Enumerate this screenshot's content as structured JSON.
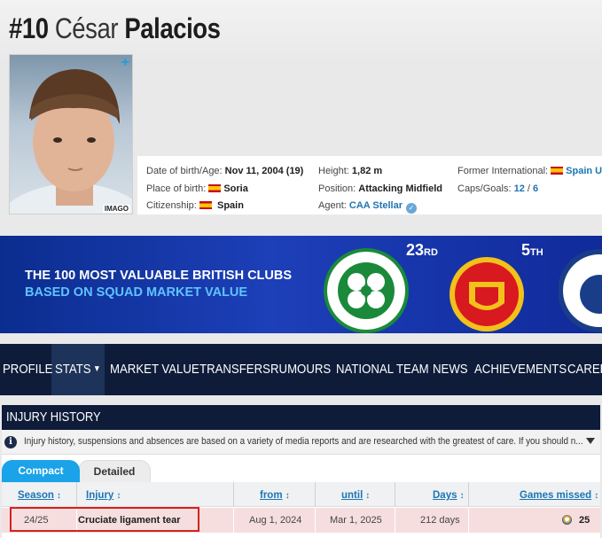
{
  "player": {
    "number": "#10",
    "first_name": "César",
    "last_name": "Palacios",
    "photo_credit": "IMAGO",
    "add_icon": "plus-icon"
  },
  "info": {
    "dob_label": "Date of birth/Age:",
    "dob_value": "Nov 11, 2004 (19)",
    "pob_label": "Place of birth:",
    "pob_value": "Soria",
    "citizenship_label": "Citizenship:",
    "citizenship_value": "Spain",
    "height_label": "Height:",
    "height_value": "1,82 m",
    "position_label": "Position:",
    "position_value": "Attacking Midfield",
    "agent_label": "Agent:",
    "agent_value": "CAA Stellar",
    "former_label": "Former International:",
    "former_value": "Spain U",
    "caps_label": "Caps/Goals:",
    "caps_value": "12",
    "caps_sep": " / ",
    "goals_value": "6"
  },
  "banner": {
    "line1": "THE 100 MOST VALUABLE BRITISH CLUBS",
    "line2": "BASED ON SQUAD MARKET VALUE",
    "rank1_num": "23",
    "rank1_suffix": "RD",
    "rank2_num": "5",
    "rank2_suffix": "TH",
    "colors": {
      "bg": "#1d3fb8",
      "accent": "#5fc3ff"
    }
  },
  "nav": {
    "items": [
      "PROFILE",
      "STATS",
      "▼",
      "MARKET VALUE",
      "TRANSFERS",
      "RUMOURS",
      "NATIONAL TEAM",
      "NEWS",
      "ACHIEVEMENTS",
      "CAREE"
    ]
  },
  "injury": {
    "title": "INJURY HISTORY",
    "notice": "Injury history, suspensions and absences are based on a variety of media reports and are researched with the greatest of care. If you should n...",
    "tabs": {
      "compact": "Compact",
      "detailed": "Detailed"
    },
    "columns": {
      "season": "Season",
      "injury": "Injury",
      "from": "from",
      "until": "until",
      "days": "Days",
      "games_missed": "Games missed",
      "sort": "↕"
    },
    "rows": [
      {
        "season": "24/25",
        "injury": "Cruciate ligament tear",
        "from": "Aug 1, 2024",
        "until": "Mar 1, 2025",
        "days": "212 days",
        "games_missed": "25"
      }
    ],
    "colors": {
      "header": "#0e1c3a",
      "active_tab": "#1aa3e8",
      "row_bg": "#f6dede",
      "highlight": "#d42222"
    }
  }
}
